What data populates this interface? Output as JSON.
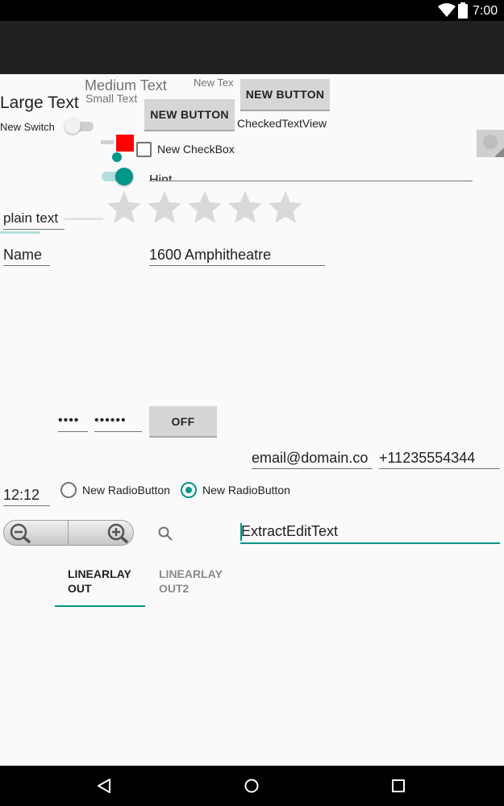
{
  "status_bar": {
    "time": "7:00",
    "icons": [
      "wifi-icon",
      "battery-icon"
    ]
  },
  "widgets": {
    "large_text": "Large Text",
    "medium_text": "Medium Text",
    "small_text": "Small Text",
    "new_text_clipped": "New Tex",
    "new_button_1": "NEW BUTTON",
    "new_button_2": "NEW BUTTON",
    "checked_text_view": "CheckedTextView",
    "new_switch": "New Switch",
    "checkbox_label": "New CheckBox",
    "hint_clipped": "Hint",
    "plain_text": "plain text",
    "name_field": "Name",
    "address_field": "1600 Amphitheatre",
    "password_1": "••••",
    "password_2": "••••••",
    "toggle_button": "OFF",
    "email_field": "email@domain.co",
    "phone_field": "+11235554344",
    "time_field": "12:12",
    "radio_1": "New RadioButton",
    "radio_2": "New RadioButton",
    "extract_edit_text": "ExtractEditText"
  },
  "rating": {
    "stars": 5,
    "value": 0
  },
  "tabs": [
    {
      "label": "LINEARLAY OUT",
      "line1": "LINEARLAY",
      "line2": "OUT",
      "selected": true
    },
    {
      "label": "LINEARLAY OUT2",
      "line1": "LINEARLAY",
      "line2": "OUT2",
      "selected": false
    }
  ],
  "colors": {
    "accent": "#009688",
    "red_block": "#ff0000",
    "app_bar": "#212121",
    "background": "#fafafa"
  },
  "nav_bar": {
    "icons": [
      "back-icon",
      "home-icon",
      "recents-icon"
    ]
  }
}
